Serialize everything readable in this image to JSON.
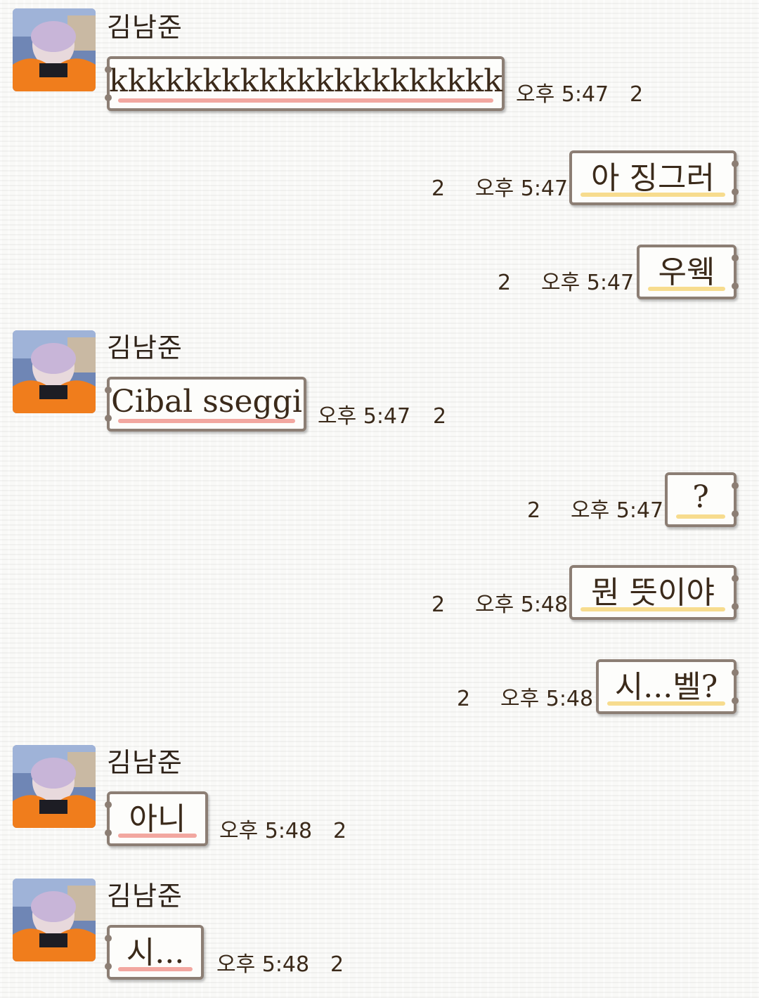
{
  "chat": {
    "messages": [
      {
        "sender": "김남준",
        "text": "kkkkkkkkkkkkkkkkkkkkk",
        "time": "오후 5:47",
        "unread": "2",
        "direction": "incoming"
      },
      {
        "text": "아 징그러",
        "time": "오후 5:47",
        "unread": "2",
        "direction": "outgoing"
      },
      {
        "text": "우웩",
        "time": "오후 5:47",
        "unread": "2",
        "direction": "outgoing"
      },
      {
        "sender": "김남준",
        "text": "Cibal sseggi",
        "time": "오후 5:47",
        "unread": "2",
        "direction": "incoming"
      },
      {
        "text": "?",
        "time": "오후 5:47",
        "unread": "2",
        "direction": "outgoing"
      },
      {
        "text": "뭔 뜻이야",
        "time": "오후 5:48",
        "unread": "2",
        "direction": "outgoing"
      },
      {
        "text": "시...벨?",
        "time": "오후 5:48",
        "unread": "2",
        "direction": "outgoing"
      },
      {
        "sender": "김남준",
        "text": "아니",
        "time": "오후 5:48",
        "unread": "2",
        "direction": "incoming"
      },
      {
        "sender": "김남준",
        "text": "시...",
        "time": "오후 5:48",
        "unread": "2",
        "direction": "incoming"
      }
    ]
  },
  "colors": {
    "bubble_border": "#8c7e74",
    "incoming_underline": "#f2a7a0",
    "outgoing_underline": "#f7dc8e",
    "text": "#3b2a1a"
  },
  "icons": {
    "avatar": "profile-photo"
  }
}
